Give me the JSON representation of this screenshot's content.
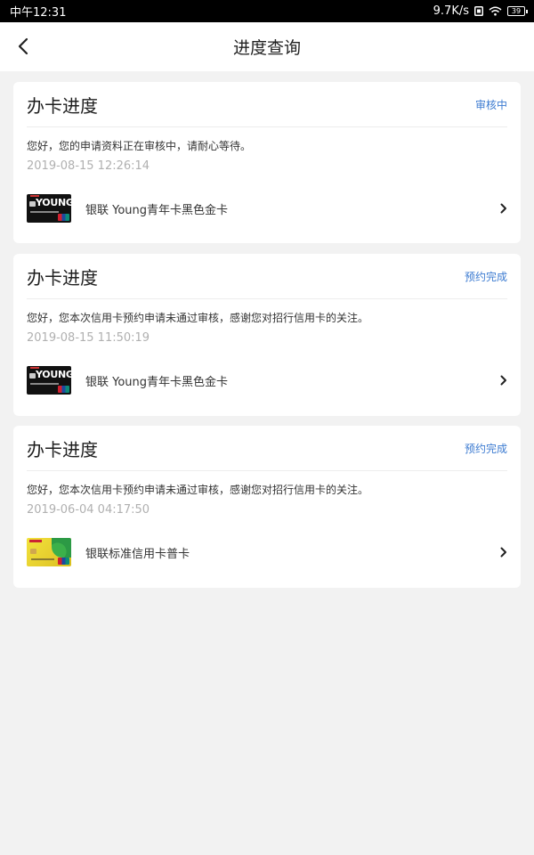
{
  "status_bar": {
    "time": "中午12:31",
    "speed": "9.7K/s",
    "battery": "39"
  },
  "nav": {
    "title": "进度查询"
  },
  "cards": [
    {
      "title": "办卡进度",
      "status": "审核中",
      "message": "您好，您的申请资料正在审核中，请耐心等待。",
      "time": "2019-08-15 12:26:14",
      "card_name": "银联 Young青年卡黑色金卡",
      "card_image_text": "YOUNG"
    },
    {
      "title": "办卡进度",
      "status": "预约完成",
      "message": "您好，您本次信用卡预约申请未通过审核，感谢您对招行信用卡的关注。",
      "time": "2019-08-15 11:50:19",
      "card_name": "银联 Young青年卡黑色金卡",
      "card_image_text": "YOUNG"
    },
    {
      "title": "办卡进度",
      "status": "预约完成",
      "message": "您好，您本次信用卡预约申请未通过审核，感谢您对招行信用卡的关注。",
      "time": "2019-06-04 04:17:50",
      "card_name": "银联标准信用卡普卡"
    }
  ],
  "colors": {
    "status_blue": "#3c7bd1",
    "background": "#f2f2f2",
    "time_gray": "#b0b0b0"
  },
  "icons": [
    "back-arrow-icon",
    "chevron-right-icon",
    "wifi-icon",
    "battery-icon",
    "sim-icon"
  ]
}
